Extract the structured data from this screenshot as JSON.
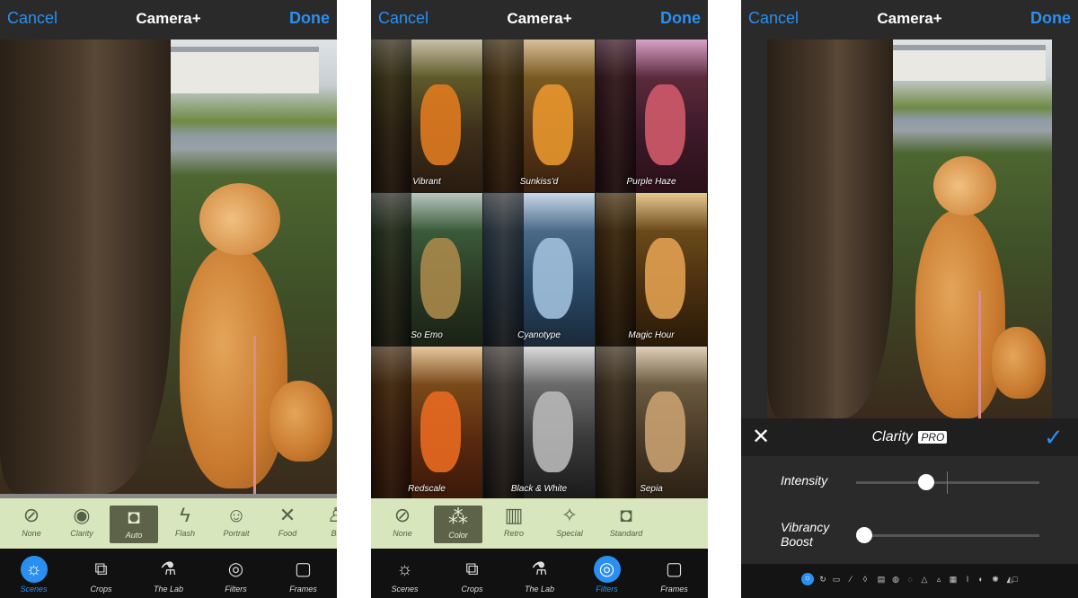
{
  "nav": {
    "cancel": "Cancel",
    "title": "Camera+",
    "done": "Done"
  },
  "screen1": {
    "scenes": [
      {
        "label": "None",
        "icon": "none-icon"
      },
      {
        "label": "Clarity",
        "icon": "eye-icon"
      },
      {
        "label": "Auto",
        "icon": "camera-icon",
        "active": true
      },
      {
        "label": "Flash",
        "icon": "flash-icon"
      },
      {
        "label": "Portrait",
        "icon": "portrait-icon"
      },
      {
        "label": "Food",
        "icon": "fork-knife-icon"
      },
      {
        "label": "Ba",
        "icon": "person-icon"
      }
    ]
  },
  "screen2": {
    "filters": [
      "Vibrant",
      "Sunkiss'd",
      "Purple Haze",
      "So Emo",
      "Cyanotype",
      "Magic Hour",
      "Redscale",
      "Black & White",
      "Sepia"
    ],
    "categories": [
      {
        "label": "None",
        "icon": "none-icon"
      },
      {
        "label": "Color",
        "icon": "color-circles-icon",
        "active": true
      },
      {
        "label": "Retro",
        "icon": "retro-icon"
      },
      {
        "label": "Special",
        "icon": "magic-wand-icon"
      },
      {
        "label": "Standard",
        "icon": "camera-icon"
      }
    ]
  },
  "tabs": [
    {
      "label": "Scenes",
      "icon": "scenes-icon"
    },
    {
      "label": "Crops",
      "icon": "crop-icon"
    },
    {
      "label": "The Lab",
      "icon": "flask-icon"
    },
    {
      "label": "Filters",
      "icon": "filters-icon"
    },
    {
      "label": "Frames",
      "icon": "frames-icon"
    }
  ],
  "screen3": {
    "edit_title": "Clarity",
    "pro_badge": "PRO",
    "intensity_label": "Intensity",
    "intensity_value": 0.37,
    "vibrancy_label": "Vibrancy Boost",
    "vibrancy_value": 0.0
  },
  "colors": {
    "accent": "#2a8ff0",
    "toolbar": "#d8e6bd",
    "navbar": "#2a2a2a"
  }
}
